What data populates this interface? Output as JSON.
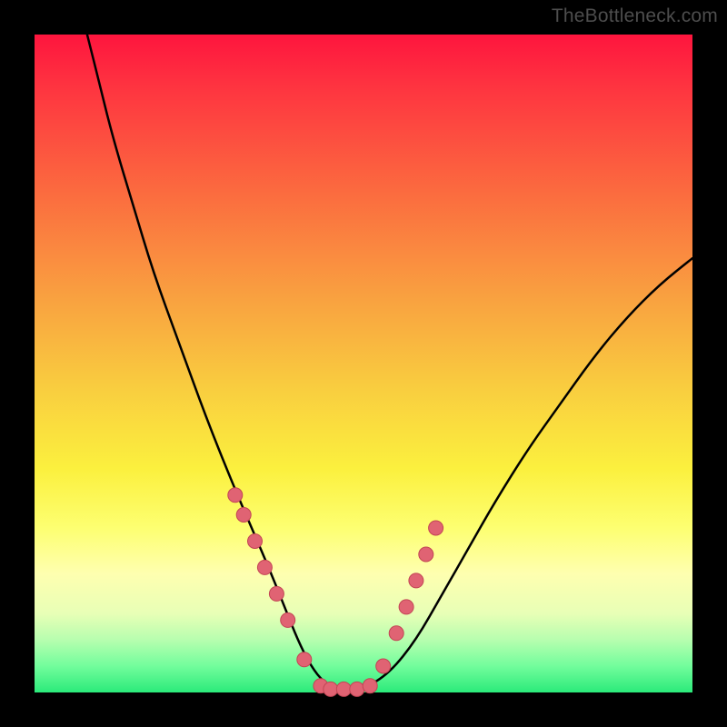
{
  "watermark": "TheBottleneck.com",
  "colors": {
    "frame": "#000000",
    "gradient_top": "#fe153e",
    "gradient_bottom": "#2bea7a",
    "curve_stroke": "#000000",
    "marker_fill": "#e06373",
    "marker_stroke": "#c24554"
  },
  "chart_data": {
    "type": "line",
    "title": "",
    "xlabel": "",
    "ylabel": "",
    "xlim": [
      0,
      100
    ],
    "ylim": [
      0,
      100
    ],
    "note": "Axes have no tick labels in the source image; values are estimated fractions of the plot area (0–100).",
    "series": [
      {
        "name": "curve",
        "x": [
          8,
          10,
          12,
          15,
          18,
          22,
          26,
          30,
          33,
          36,
          38,
          40,
          42,
          44,
          46,
          48,
          50,
          54,
          58,
          62,
          66,
          70,
          75,
          80,
          85,
          90,
          95,
          100
        ],
        "y": [
          100,
          92,
          84,
          74,
          64,
          53,
          42,
          32,
          25,
          18,
          13,
          8,
          4,
          1.5,
          0.5,
          0.5,
          0.5,
          3,
          8,
          15,
          22,
          29,
          37,
          44,
          51,
          57,
          62,
          66
        ]
      }
    ],
    "markers": {
      "name": "highlighted-points",
      "x": [
        30.5,
        31.8,
        33.5,
        35.0,
        36.8,
        38.5,
        41.0,
        43.5,
        45.0,
        47.0,
        49.0,
        51.0,
        53.0,
        55.0,
        56.5,
        58.0,
        59.5,
        61.0
      ],
      "y": [
        30,
        27,
        23,
        19,
        15,
        11,
        5,
        1,
        0.5,
        0.5,
        0.5,
        1,
        4,
        9,
        13,
        17,
        21,
        25
      ]
    },
    "flat_segment": {
      "x_start": 44,
      "x_end": 50,
      "y": 0.5
    }
  }
}
